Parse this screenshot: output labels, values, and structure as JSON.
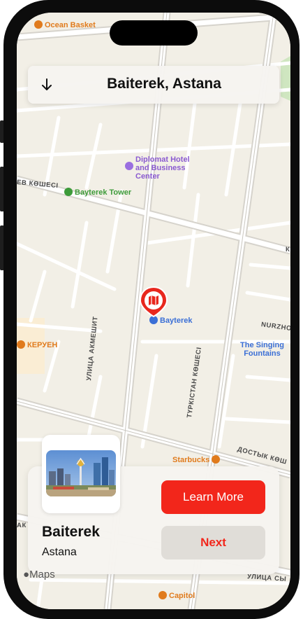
{
  "header": {
    "title": "Baiterek, Astana",
    "back_icon": "arrow-down-icon"
  },
  "map": {
    "pois": {
      "ocean_basket": "Ocean Basket",
      "diplomat_line1": "Diplomat Hotel",
      "diplomat_line2": "and Business",
      "diplomat_line3": "Center",
      "bayterek_tower": "Bayterek Tower",
      "bayterek": "Bayterek",
      "keruen": "КЕРУЕН",
      "singing_line1": "The Singing",
      "singing_line2": "Fountains",
      "starbucks": "Starbucks",
      "capitol": "Capitol"
    },
    "streets": {
      "left_street": "ЕВ КӨШЕСІ",
      "akmeshit": "УЛИЦА АКМЕШИТ",
      "turkistan": "ТҮРКІСТАН КӨШЕСІ",
      "nurzhol": "NURZHO",
      "dostyk": "ДОСТЫК КӨШ",
      "bottom_left": "АК",
      "bottom_right": "УЛИЦА СЫ",
      "edge_k": "К"
    },
    "maps_logo": "Maps",
    "pin_icon": "map-pin-icon"
  },
  "card": {
    "name": "Baiterek",
    "city": "Astana",
    "learn_more": "Learn More",
    "next": "Next",
    "thumbnail_icon": "baiterek-photo"
  },
  "colors": {
    "accent": "#f2261b",
    "next_bg": "#e0ddd8",
    "map_bg": "#f2efe6"
  }
}
